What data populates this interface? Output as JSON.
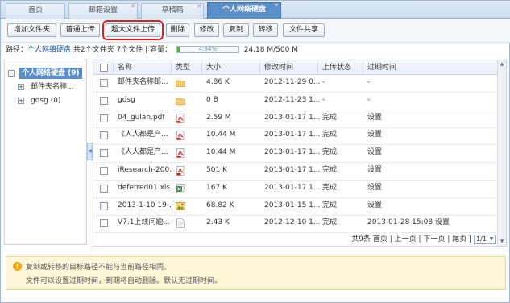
{
  "tabs": [
    {
      "label": "首页",
      "active": false,
      "closable": false
    },
    {
      "label": "邮箱设置",
      "active": false,
      "closable": true
    },
    {
      "label": "草稿箱",
      "active": false,
      "closable": true
    },
    {
      "label": "个人网络硬盘",
      "active": true,
      "closable": true
    }
  ],
  "toolbar": {
    "add_folder": "增加文件夹",
    "normal_upload": "普通上传",
    "large_upload": "超大文件上传",
    "delete": "删除",
    "modify": "修改",
    "copy": "复制",
    "move": "转移",
    "share": "文件共享"
  },
  "path": {
    "prefix": "路径：",
    "current": "个人网络硬盘",
    "summary": "共2个文件夹 7个文件 | 容量：",
    "quota_percent_text": "4.84%",
    "quota_fraction": 0.0484,
    "usage": "24.18 M/500 M"
  },
  "tree": {
    "root": "个人网络硬盘 (9)",
    "root_toggle": "−",
    "children": [
      {
        "toggle": "+",
        "label": "邮件夹名称..."
      },
      {
        "toggle": "+",
        "label": "gdsg (0)"
      }
    ]
  },
  "table": {
    "columns": {
      "name": "名称",
      "type": "类型",
      "size": "大小",
      "modified": "修改时间",
      "upload_status": "上传状态",
      "expiry": "过期时间"
    },
    "rows": [
      {
        "name": "邮件夹名称邮...",
        "icon": "folder-icon",
        "size": "4.86 K",
        "modified": "2012-11-29 0...",
        "status": "-",
        "expiry": "-"
      },
      {
        "name": "gdsg",
        "icon": "folder-icon",
        "size": "0 B",
        "modified": "2012-11-23 1...",
        "status": "-",
        "expiry": "-"
      },
      {
        "name": "04_gulan.pdf",
        "icon": "pdf-icon",
        "size": "2.59 M",
        "modified": "2013-01-17 1...",
        "status": "完成",
        "expiry": "设置"
      },
      {
        "name": "《人人都是产...",
        "icon": "pdf-icon",
        "size": "10.44 M",
        "modified": "2013-01-17 1...",
        "status": "完成",
        "expiry": "设置"
      },
      {
        "name": "《人人都是产...",
        "icon": "pdf-icon",
        "size": "10.44 M",
        "modified": "2013-01-17 1...",
        "status": "完成",
        "expiry": "设置"
      },
      {
        "name": "iResearch-200...",
        "icon": "pdf-icon",
        "size": "501 K",
        "modified": "2013-01-17 1...",
        "status": "完成",
        "expiry": "设置"
      },
      {
        "name": "deferred01.xls",
        "icon": "excel-icon",
        "size": "167 K",
        "modified": "2013-01-17 1...",
        "status": "完成",
        "expiry": "设置"
      },
      {
        "name": "2013-1-10 19-...",
        "icon": "image-icon",
        "size": "68.82 K",
        "modified": "2013-01-15 1...",
        "status": "完成",
        "expiry": "设置"
      },
      {
        "name": "V7.1上线问题...",
        "icon": "document-icon",
        "size": "2.43 K",
        "modified": "2012-12-10 1...",
        "status": "完成",
        "expiry": "2013-01-28 15:08 设置"
      }
    ]
  },
  "pager": {
    "total": "共9条",
    "first": "首页",
    "prev": "上一页",
    "next": "下一页",
    "last": "尾页",
    "page": "1/1"
  },
  "notice": {
    "line1": "复制或转移的目标路径不能与当前路径相同。",
    "line2": "文件可以设置过期时间，到期将自动删除。默认无过期时间。"
  }
}
